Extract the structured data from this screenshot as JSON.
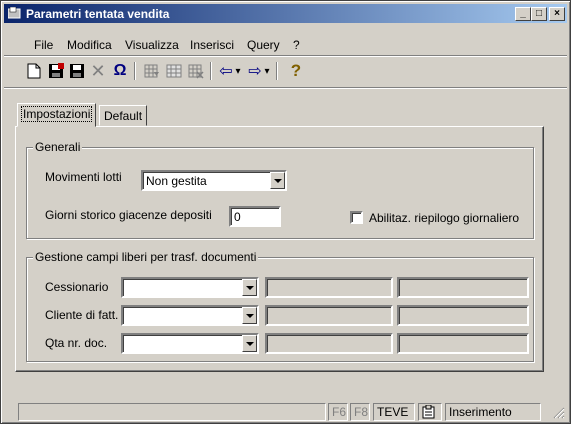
{
  "window": {
    "title": "Parametri tentata vendita",
    "controls": {
      "minimize": "_",
      "maximize": "□",
      "close": "×"
    }
  },
  "menu": [
    "File",
    "Modifica",
    "Visualizza",
    "Inserisci",
    "Query",
    "?"
  ],
  "toolbar": {
    "icons": [
      "new-doc-icon",
      "save-all-icon",
      "save-icon",
      "delete-icon",
      "undo-icon",
      "filter-icon",
      "grid-icon",
      "clear-filter-icon",
      "prev-icon",
      "next-icon",
      "help-icon"
    ],
    "glyphs": {
      "delete": "✕",
      "undo": "Ω",
      "prev": "⇦",
      "next": "⇨",
      "dropdown": "▾",
      "help": "?"
    }
  },
  "tabs": [
    {
      "label": "Impostazioni",
      "active": true
    },
    {
      "label": "Default",
      "active": false
    }
  ],
  "generali": {
    "legend": "Generali",
    "movimenti_lotti_label": "Movimenti lotti",
    "movimenti_lotti_value": "Non gestita",
    "giorni_storico_label": "Giorni storico giacenze depositi",
    "giorni_storico_value": "0",
    "riepilogo_label": "Abilitaz. riepilogo giornaliero",
    "riepilogo_checked": false
  },
  "campi_liberi": {
    "legend": "Gestione campi liberi per trasf. documenti",
    "rows": [
      {
        "label": "Cessionario",
        "value": ""
      },
      {
        "label": "Cliente di fatt.",
        "value": ""
      },
      {
        "label": "Qta nr. doc.",
        "value": ""
      }
    ]
  },
  "status": {
    "f6": "F6",
    "f8": "F8",
    "code": "TEVE",
    "mode": "Inserimento"
  },
  "colors": {
    "title_start": "#0a246a",
    "title_end": "#a6caf0",
    "face": "#d4d0c8"
  }
}
